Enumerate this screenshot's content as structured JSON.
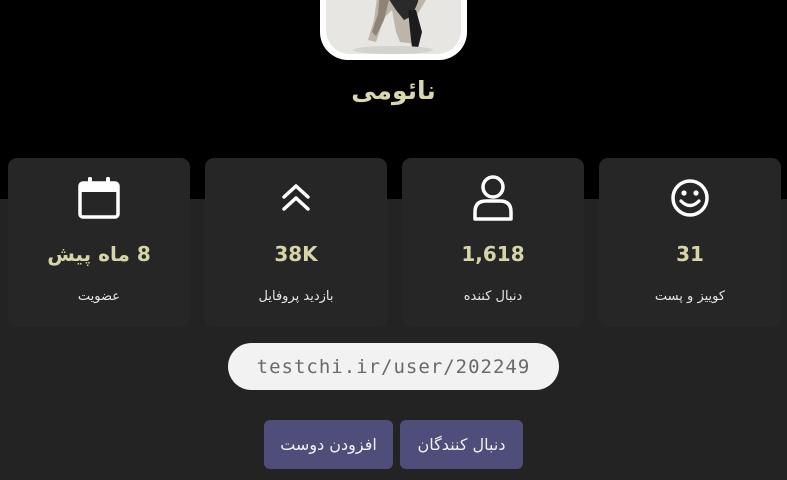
{
  "profile": {
    "username": "نائومی"
  },
  "stats": [
    {
      "icon": "calendar-icon",
      "value": "8 ماه پیش",
      "label": "عضویت"
    },
    {
      "icon": "double-chevron-up-icon",
      "value": "38K",
      "label": "بازدید پروفایل"
    },
    {
      "icon": "user-icon",
      "value": "1,618",
      "label": "دنبال کننده"
    },
    {
      "icon": "smiley-icon",
      "value": "31",
      "label": "کوییز و پست"
    }
  ],
  "profile_link": {
    "url": "testchi.ir/user/202249"
  },
  "actions": {
    "add_friend_label": "افزودن دوست",
    "followers_label": "دنبال کنندگان"
  },
  "colors": {
    "background_top": "#000000",
    "background_bottom": "#232323",
    "card": "#262626",
    "accent_text": "#d7d4a8",
    "button": "#4f4d79"
  }
}
